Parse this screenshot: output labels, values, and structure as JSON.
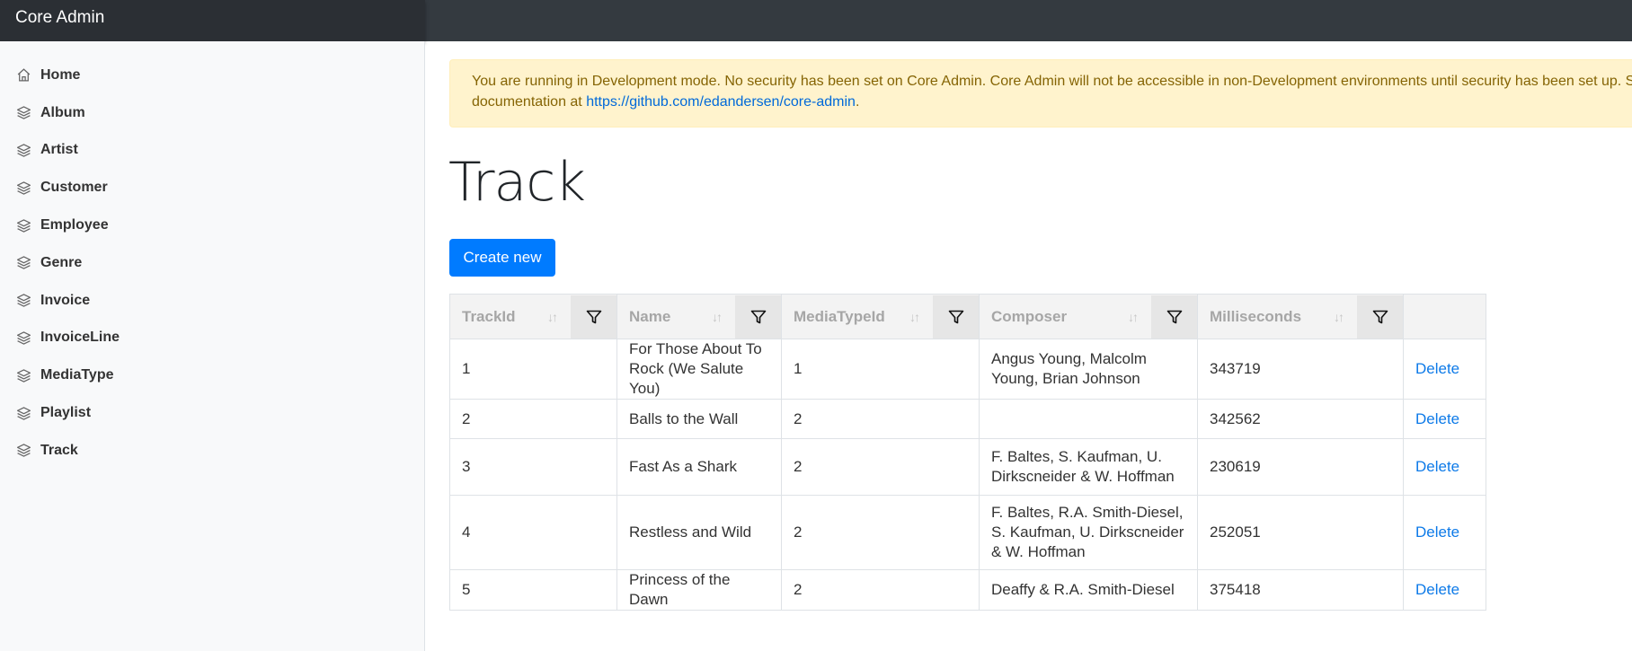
{
  "app": {
    "title": "Core Admin"
  },
  "sidebar": {
    "items": [
      {
        "label": "Home",
        "icon": "home-icon"
      },
      {
        "label": "Album",
        "icon": "layers-icon"
      },
      {
        "label": "Artist",
        "icon": "layers-icon"
      },
      {
        "label": "Customer",
        "icon": "layers-icon"
      },
      {
        "label": "Employee",
        "icon": "layers-icon"
      },
      {
        "label": "Genre",
        "icon": "layers-icon"
      },
      {
        "label": "Invoice",
        "icon": "layers-icon"
      },
      {
        "label": "InvoiceLine",
        "icon": "layers-icon"
      },
      {
        "label": "MediaType",
        "icon": "layers-icon"
      },
      {
        "label": "Playlist",
        "icon": "layers-icon"
      },
      {
        "label": "Track",
        "icon": "layers-icon"
      }
    ]
  },
  "alert": {
    "text": "You are running in Development mode. No security has been set on Core Admin. Core Admin will not be accessible in non-Development environments until security has been set up. See t",
    "text2": "documentation at ",
    "link": "https://github.com/edandersen/core-admin",
    "after": "."
  },
  "page": {
    "title": "Track",
    "create_label": "Create new"
  },
  "table": {
    "columns": [
      "TrackId",
      "Name",
      "MediaTypeId",
      "Composer",
      "Milliseconds"
    ],
    "sort_icon": "sort-icon",
    "filter_icon": "filter-icon",
    "delete_label": "Delete",
    "rows": [
      {
        "id": "1",
        "name": "For Those About To Rock (We Salute You)",
        "media": "1",
        "composer": "Angus Young, Malcolm Young, Brian Johnson",
        "ms": "343719"
      },
      {
        "id": "2",
        "name": "Balls to the Wall",
        "media": "2",
        "composer": "",
        "ms": "342562"
      },
      {
        "id": "3",
        "name": "Fast As a Shark",
        "media": "2",
        "composer": "F. Baltes, S. Kaufman, U. Dirkscneider & W. Hoffman",
        "ms": "230619"
      },
      {
        "id": "4",
        "name": "Restless and Wild",
        "media": "2",
        "composer": "F. Baltes, R.A. Smith-Diesel, S. Kaufman, U. Dirkscneider & W. Hoffman",
        "ms": "252051"
      },
      {
        "id": "5",
        "name": "Princess of the Dawn",
        "media": "2",
        "composer": "Deaffy & R.A. Smith-Diesel",
        "ms": "375418"
      }
    ]
  },
  "colors": {
    "topbar": "#343a40",
    "primary": "#007bff",
    "alert_bg": "#fff3cd",
    "alert_text": "#856404"
  }
}
